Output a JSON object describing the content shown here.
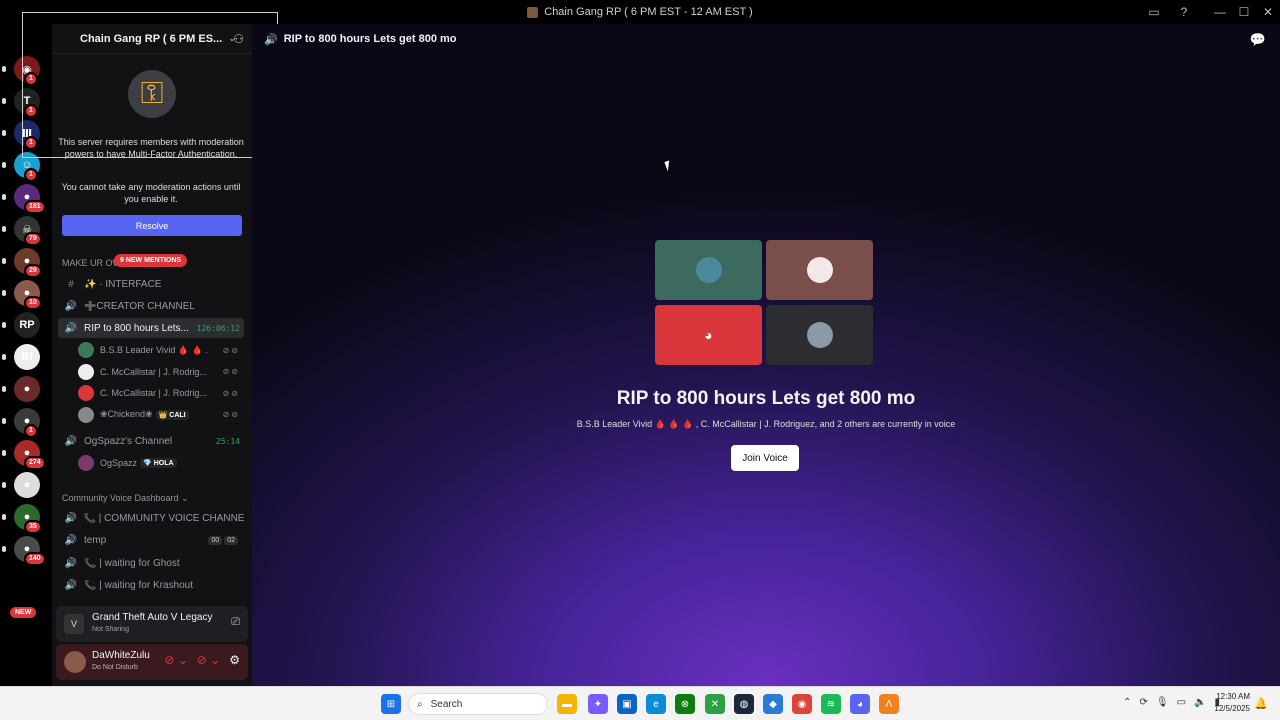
{
  "window": {
    "title": "Chain Gang RP ( 6 PM EST - 12 AM EST )",
    "controls": [
      "—",
      "☐",
      "✕"
    ],
    "toolbar_icons": [
      "inbox-icon",
      "help-icon"
    ]
  },
  "rail": {
    "servers": [
      {
        "badge": "1",
        "color": "#7a1a1a",
        "glyph": "◉"
      },
      {
        "badge": "1",
        "color": "#222222",
        "glyph": "T"
      },
      {
        "badge": "1",
        "color": "#1a2a6a",
        "glyph": "Ⅲ"
      },
      {
        "badge": "1",
        "color": "#1aa0d0",
        "glyph": "☺"
      },
      {
        "badge": "181",
        "color": "#5a2a7a",
        "glyph": "●"
      },
      {
        "badge": "79",
        "color": "#333333",
        "glyph": "☠"
      },
      {
        "badge": "29",
        "color": "#6a3a2a",
        "glyph": "●"
      },
      {
        "badge": "10",
        "color": "#8a5a4a",
        "glyph": "●"
      },
      {
        "badge": "",
        "color": "#222222",
        "glyph": "RP"
      },
      {
        "badge": "",
        "color": "#eeeeee",
        "glyph": "Bf"
      },
      {
        "badge": "",
        "color": "#6a2a2a",
        "glyph": "●"
      },
      {
        "badge": "1",
        "color": "#3a3a3a",
        "glyph": "●"
      },
      {
        "badge": "274",
        "color": "#aa2a2a",
        "glyph": "●"
      },
      {
        "badge": "",
        "color": "#dddddd",
        "glyph": "●"
      },
      {
        "badge": "35",
        "color": "#2a6a2a",
        "glyph": "●"
      },
      {
        "badge": "140",
        "color": "#4a4a4a",
        "glyph": "●"
      }
    ],
    "new_label": "NEW"
  },
  "sidebar": {
    "server_name": "Chain Gang RP ( 6 PM ES...",
    "mfa": {
      "text1": "This server requires members with moderation powers to have Multi-Factor Authentication.",
      "text2": "You cannot take any moderation actions until you enable it.",
      "resolve": "Resolve"
    },
    "category1": "MAKE UR OW",
    "mentions": "9 NEW MENTIONS",
    "channels": [
      {
        "icon": "#",
        "label": "✨ · INTERFACE"
      },
      {
        "icon": "🔊",
        "label": "➕CREATOR CHANNEL"
      },
      {
        "icon": "🔊",
        "label": "RIP to 800 hours Lets...",
        "timer": "126:06:12"
      }
    ],
    "members1": [
      {
        "name": "B.S.B Leader Vivid 🩸 🩸 ...",
        "status": "⊘⊘",
        "color": "#3a7a5a"
      },
      {
        "name": "C. McCallistar | J. Rodrig...",
        "status": "⊘⊘",
        "color": "#eeeeee"
      },
      {
        "name": "C. McCallistar | J. Rodrig...",
        "status": "⊘⊘",
        "color": "#da373c"
      },
      {
        "name": "❀Chickend❀",
        "tag": "👑 CALI",
        "status": "⊘⊘",
        "color": "#888888"
      }
    ],
    "channel_og": {
      "icon": "🔊",
      "label": "OgSpazz's Channel",
      "timer": "25:14"
    },
    "members2": [
      {
        "name": "OgSpazz",
        "tag": "💎 HOLA",
        "color": "#7a3a6a"
      }
    ],
    "category2": "Community Voice Dashboard",
    "channels2": [
      {
        "icon": "🔊",
        "label": "📞 | COMMUNITY VOICE CHANNEL"
      },
      {
        "icon": "🔊",
        "label": "temp",
        "count": [
          "00",
          "02"
        ]
      },
      {
        "icon": "🔊",
        "label": "📞 | waiting for Ghost"
      },
      {
        "icon": "🔊",
        "label": "📞 | waiting for Krashout"
      }
    ],
    "activity": {
      "game": "Grand Theft Auto V Legacy",
      "status": "Not Sharing"
    },
    "user": {
      "name": "DaWhiteZulu",
      "status": "Do Not Disturb"
    }
  },
  "main": {
    "header_title": "RIP to 800 hours Lets get 800 mo",
    "tiles": [
      {
        "bg": "#3d6a5e",
        "avatar": "#4a8a9a"
      },
      {
        "bg": "#7a4e4a",
        "avatar": "#f2e8e8"
      },
      {
        "bg": "#da373c",
        "avatar": "#da373c"
      },
      {
        "bg": "#2b2d31",
        "avatar": "#8a9aa8"
      }
    ],
    "voice_title": "RIP to 800 hours Lets get 800 mo",
    "voice_sub": "B.S.B Leader Vivid 🩸 🩸 🩸 , C. McCallistar | J. Rodriguez, and 2 others are currently in voice",
    "join_label": "Join Voice"
  },
  "taskbar": {
    "search_placeholder": "Search",
    "time": "12:30 AM",
    "date": "12/5/2025",
    "apps": [
      {
        "name": "start",
        "color": "#1a73e8",
        "glyph": "⊞"
      },
      {
        "name": "file-explorer",
        "color": "#f4b400",
        "glyph": "▬"
      },
      {
        "name": "copilot",
        "color": "#7a5af8",
        "glyph": "✦"
      },
      {
        "name": "store",
        "color": "#0a63c8",
        "glyph": "▣"
      },
      {
        "name": "edge",
        "color": "#0b8ad8",
        "glyph": "e"
      },
      {
        "name": "xbox-app",
        "color": "#107c10",
        "glyph": "⊗"
      },
      {
        "name": "xbox",
        "color": "#2ea043",
        "glyph": "✕"
      },
      {
        "name": "steam",
        "color": "#1b2838",
        "glyph": "◍"
      },
      {
        "name": "app-blue",
        "color": "#2a7ad8",
        "glyph": "◆"
      },
      {
        "name": "chrome",
        "color": "#db4437",
        "glyph": "◉"
      },
      {
        "name": "spotify",
        "color": "#1db954",
        "glyph": "≋"
      },
      {
        "name": "discord",
        "color": "#5865f2",
        "glyph": "◕"
      },
      {
        "name": "app-orange",
        "color": "#f4811f",
        "glyph": "Λ"
      }
    ]
  }
}
